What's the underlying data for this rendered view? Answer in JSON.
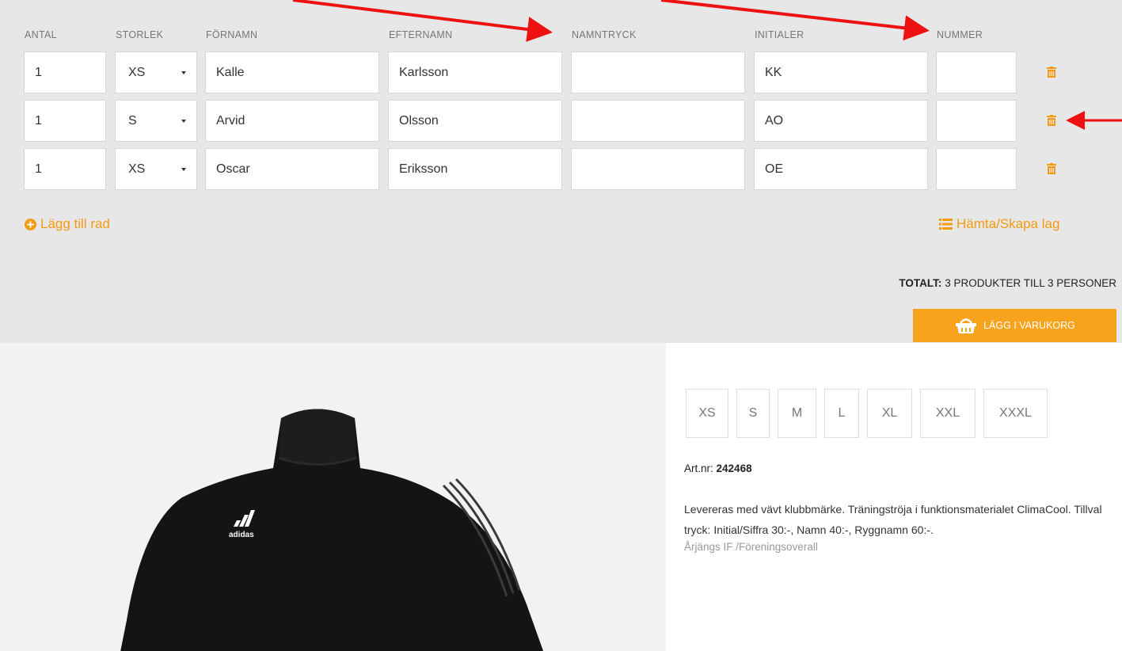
{
  "columns": [
    "ANTAL",
    "STORLEK",
    "FÖRNAMN",
    "EFTERNAMN",
    "NAMNTRYCK",
    "INITIALER",
    "NUMMER"
  ],
  "rows": [
    {
      "antal": "1",
      "storlek": "XS",
      "fornamn": "Kalle",
      "efternamn": "Karlsson",
      "namntryck": "",
      "initialer": "KK",
      "nummer": ""
    },
    {
      "antal": "1",
      "storlek": "S",
      "fornamn": "Arvid",
      "efternamn": "Olsson",
      "namntryck": "",
      "initialer": "AO",
      "nummer": ""
    },
    {
      "antal": "1",
      "storlek": "XS",
      "fornamn": "Oscar",
      "efternamn": "Eriksson",
      "namntryck": "",
      "initialer": "OE",
      "nummer": ""
    }
  ],
  "actions": {
    "add_row": "Lägg till rad",
    "team": "Hämta/Skapa lag",
    "total_label": "TOTALT:",
    "total_value": "3 PRODUKTER TILL 3 PERSONER",
    "cart": "LÄGG I VARUKORG"
  },
  "product": {
    "sizes": [
      "XS",
      "S",
      "M",
      "L",
      "XL",
      "XXL",
      "XXXL"
    ],
    "artnr_label": "Art.nr:",
    "artnr": "242468",
    "description": "Levereras med vävt klubbmärke. Träningströja i funktionsmaterialet ClimaCool. Tillval tryck: Initial/Siffra 30:-, Namn 40:-, Ryggnamn 60:-.",
    "breadcrumb": "Årjängs IF /Föreningsoverall",
    "logo_text": "adidas"
  },
  "colors": {
    "accent": "#f39a12",
    "cart_button": "#f7a31c",
    "annotation": "#ee1111"
  },
  "icons": [
    "trash-icon",
    "plus-circle-icon",
    "list-icon",
    "basket-icon",
    "chevron-down-icon"
  ]
}
